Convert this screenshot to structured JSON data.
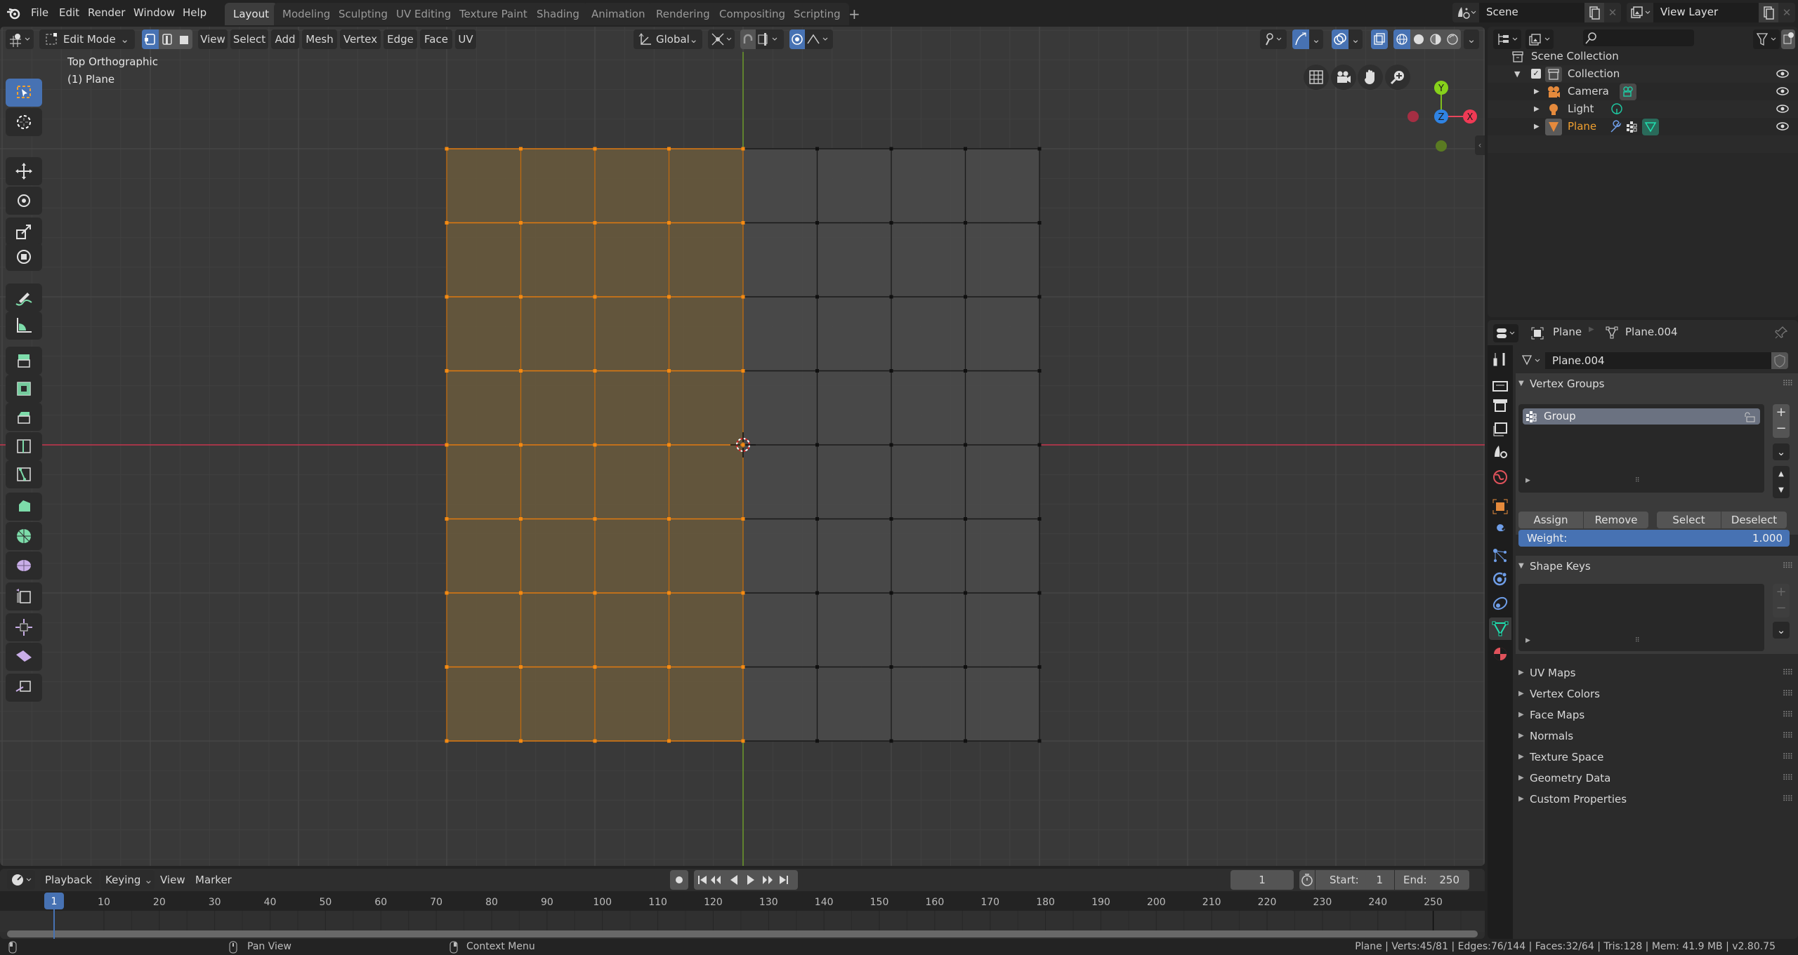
{
  "topbar": {
    "menus": [
      "File",
      "Edit",
      "Render",
      "Window",
      "Help"
    ],
    "workspaces": [
      {
        "label": "Layout",
        "active": true
      },
      {
        "label": "Modeling",
        "active": false
      },
      {
        "label": "Sculpting",
        "active": false
      },
      {
        "label": "UV Editing",
        "active": false
      },
      {
        "label": "Texture Paint",
        "active": false
      },
      {
        "label": "Shading",
        "active": false
      },
      {
        "label": "Animation",
        "active": false
      },
      {
        "label": "Rendering",
        "active": false
      },
      {
        "label": "Compositing",
        "active": false
      },
      {
        "label": "Scripting",
        "active": false
      }
    ],
    "add_workspace": "+",
    "scene": "Scene",
    "view_layer": "View Layer"
  },
  "viewport": {
    "header": {
      "mode": "Edit Mode",
      "menus": [
        "View",
        "Select",
        "Add",
        "Mesh",
        "Vertex",
        "Edge",
        "Face",
        "UV"
      ],
      "transform_orientation": "Global"
    },
    "overlay_text": {
      "view_name": "Top Orthographic",
      "object_name": "(1) Plane"
    },
    "gizmo": {
      "x": "X",
      "y": "Y",
      "z": "Z"
    },
    "tools": [
      "select-box",
      "cursor",
      "move",
      "rotate",
      "scale",
      "transform",
      "annotate",
      "measure",
      "extrude-region",
      "inset-faces",
      "bevel",
      "loop-cut",
      "knife",
      "poly-build",
      "spin",
      "smooth",
      "edge-slide",
      "shrink-fatten",
      "shear",
      "rip-region"
    ],
    "mesh": {
      "columns": 8,
      "rows": 8,
      "selected_columns": 4
    },
    "colors": {
      "selected_face": "#66583d",
      "unselected_face": "#4a4a4a",
      "selected_vertex": "#f48a12",
      "axis_x": "#c8354d",
      "axis_y": "#6c9a2a",
      "accent": "#4772b3"
    }
  },
  "outliner": {
    "root": "Scene Collection",
    "collection": "Collection",
    "items": [
      {
        "label": "Camera",
        "selected": false
      },
      {
        "label": "Light",
        "selected": false
      },
      {
        "label": "Plane",
        "selected": true
      }
    ]
  },
  "properties": {
    "breadcrumb": {
      "object": "Plane",
      "data": "Plane.004"
    },
    "mesh_name": "Plane.004",
    "vertex_groups": {
      "title": "Vertex Groups",
      "items": [
        "Group"
      ],
      "buttons": {
        "assign": "Assign",
        "remove": "Remove",
        "select": "Select",
        "deselect": "Deselect"
      },
      "weight_label": "Weight:",
      "weight_value": "1.000"
    },
    "shape_keys": {
      "title": "Shape Keys"
    },
    "collapsed_panels": [
      "UV Maps",
      "Vertex Colors",
      "Face Maps",
      "Normals",
      "Texture Space",
      "Geometry Data",
      "Custom Properties"
    ]
  },
  "timeline": {
    "menus": {
      "playback": "Playback",
      "keying": "Keying",
      "view": "View",
      "marker": "Marker"
    },
    "current_frame": "1",
    "start_label": "Start:",
    "start": "1",
    "end_label": "End:",
    "end": "250",
    "ruler": [
      "10",
      "20",
      "30",
      "40",
      "50",
      "60",
      "70",
      "80",
      "90",
      "100",
      "110",
      "120",
      "130",
      "140",
      "150",
      "160",
      "170",
      "180",
      "190",
      "200",
      "210",
      "220",
      "230",
      "240",
      "250"
    ],
    "playhead": "1"
  },
  "statusbar": {
    "left_hint": "Pan View",
    "right_hint": "Context Menu",
    "stats": "Plane | Verts:45/81 | Edges:76/144 | Faces:32/64 | Tris:128 | Mem: 41.9 MB | v2.80.75"
  }
}
